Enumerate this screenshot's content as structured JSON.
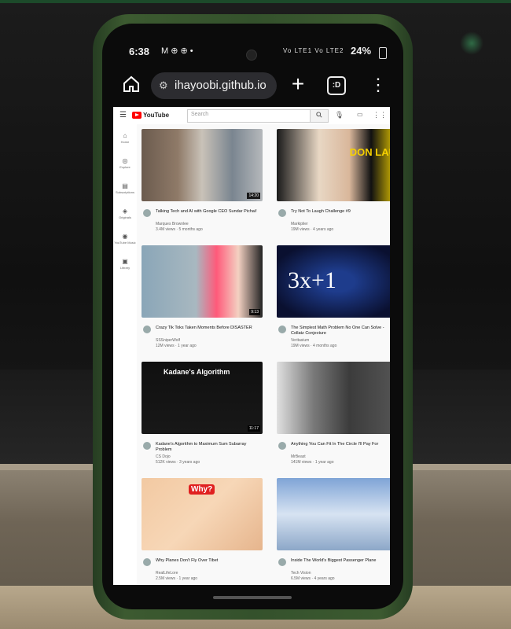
{
  "status_bar": {
    "time": "6:38",
    "icons": "M ⊕ ⊕ •",
    "network": "Vo LTE1 Vo LTE2",
    "battery": "24%"
  },
  "browser": {
    "url": "ihayoobi.github.io",
    "tab_count": ":D"
  },
  "youtube": {
    "logo_text": "YouTube",
    "search_placeholder": "Search",
    "sidebar": [
      {
        "label": "Home",
        "icon": "home-icon"
      },
      {
        "label": "Explore",
        "icon": "compass-icon"
      },
      {
        "label": "Subscriptions",
        "icon": "subscriptions-icon"
      },
      {
        "label": "Originals",
        "icon": "originals-icon"
      },
      {
        "label": "YouTube Music",
        "icon": "music-icon"
      },
      {
        "label": "Library",
        "icon": "library-icon"
      }
    ],
    "videos": [
      {
        "title": "Talking Tech and AI with Google CEO Sundar Pichai!",
        "channel": "Marques Brownlee",
        "meta": "3.4M views · 5 months ago",
        "duration": "14:20",
        "thumb_text": ""
      },
      {
        "title": "Try Not To Laugh Challenge #9",
        "channel": "Markiplier",
        "meta": "19M views · 4 years ago",
        "duration": "",
        "thumb_text": "DON LAU"
      },
      {
        "title": "Crazy Tik Toks Taken Moments Before DISASTER",
        "channel": "SSSniperWolf",
        "meta": "12M views · 1 year ago",
        "duration": "9:13",
        "thumb_text": ""
      },
      {
        "title": "The Simplest Math Problem No One Can Solve - Collatz Conjecture",
        "channel": "Veritasium",
        "meta": "19M views · 4 months ago",
        "duration": "",
        "thumb_text": "3x+1"
      },
      {
        "title": "Kadane's Algorithm to Maximum Sum Subarray Problem",
        "channel": "CS Dojo",
        "meta": "512K views · 3 years ago",
        "duration": "11:17",
        "thumb_text": "Kadane's Algorithm"
      },
      {
        "title": "Anything You Can Fit In The Circle I'll Pay For",
        "channel": "MrBeast",
        "meta": "141M views · 1 year ago",
        "duration": "",
        "thumb_text": ""
      },
      {
        "title": "Why Planes Don't Fly Over Tibet",
        "channel": "RealLifeLore",
        "meta": "2.5M views · 1 year ago",
        "duration": "",
        "thumb_text": "Why?"
      },
      {
        "title": "Inside The World's Biggest Passenger Plane",
        "channel": "Tech Vision",
        "meta": "6.5M views · 4 years ago",
        "duration": "",
        "thumb_text": ""
      }
    ]
  }
}
